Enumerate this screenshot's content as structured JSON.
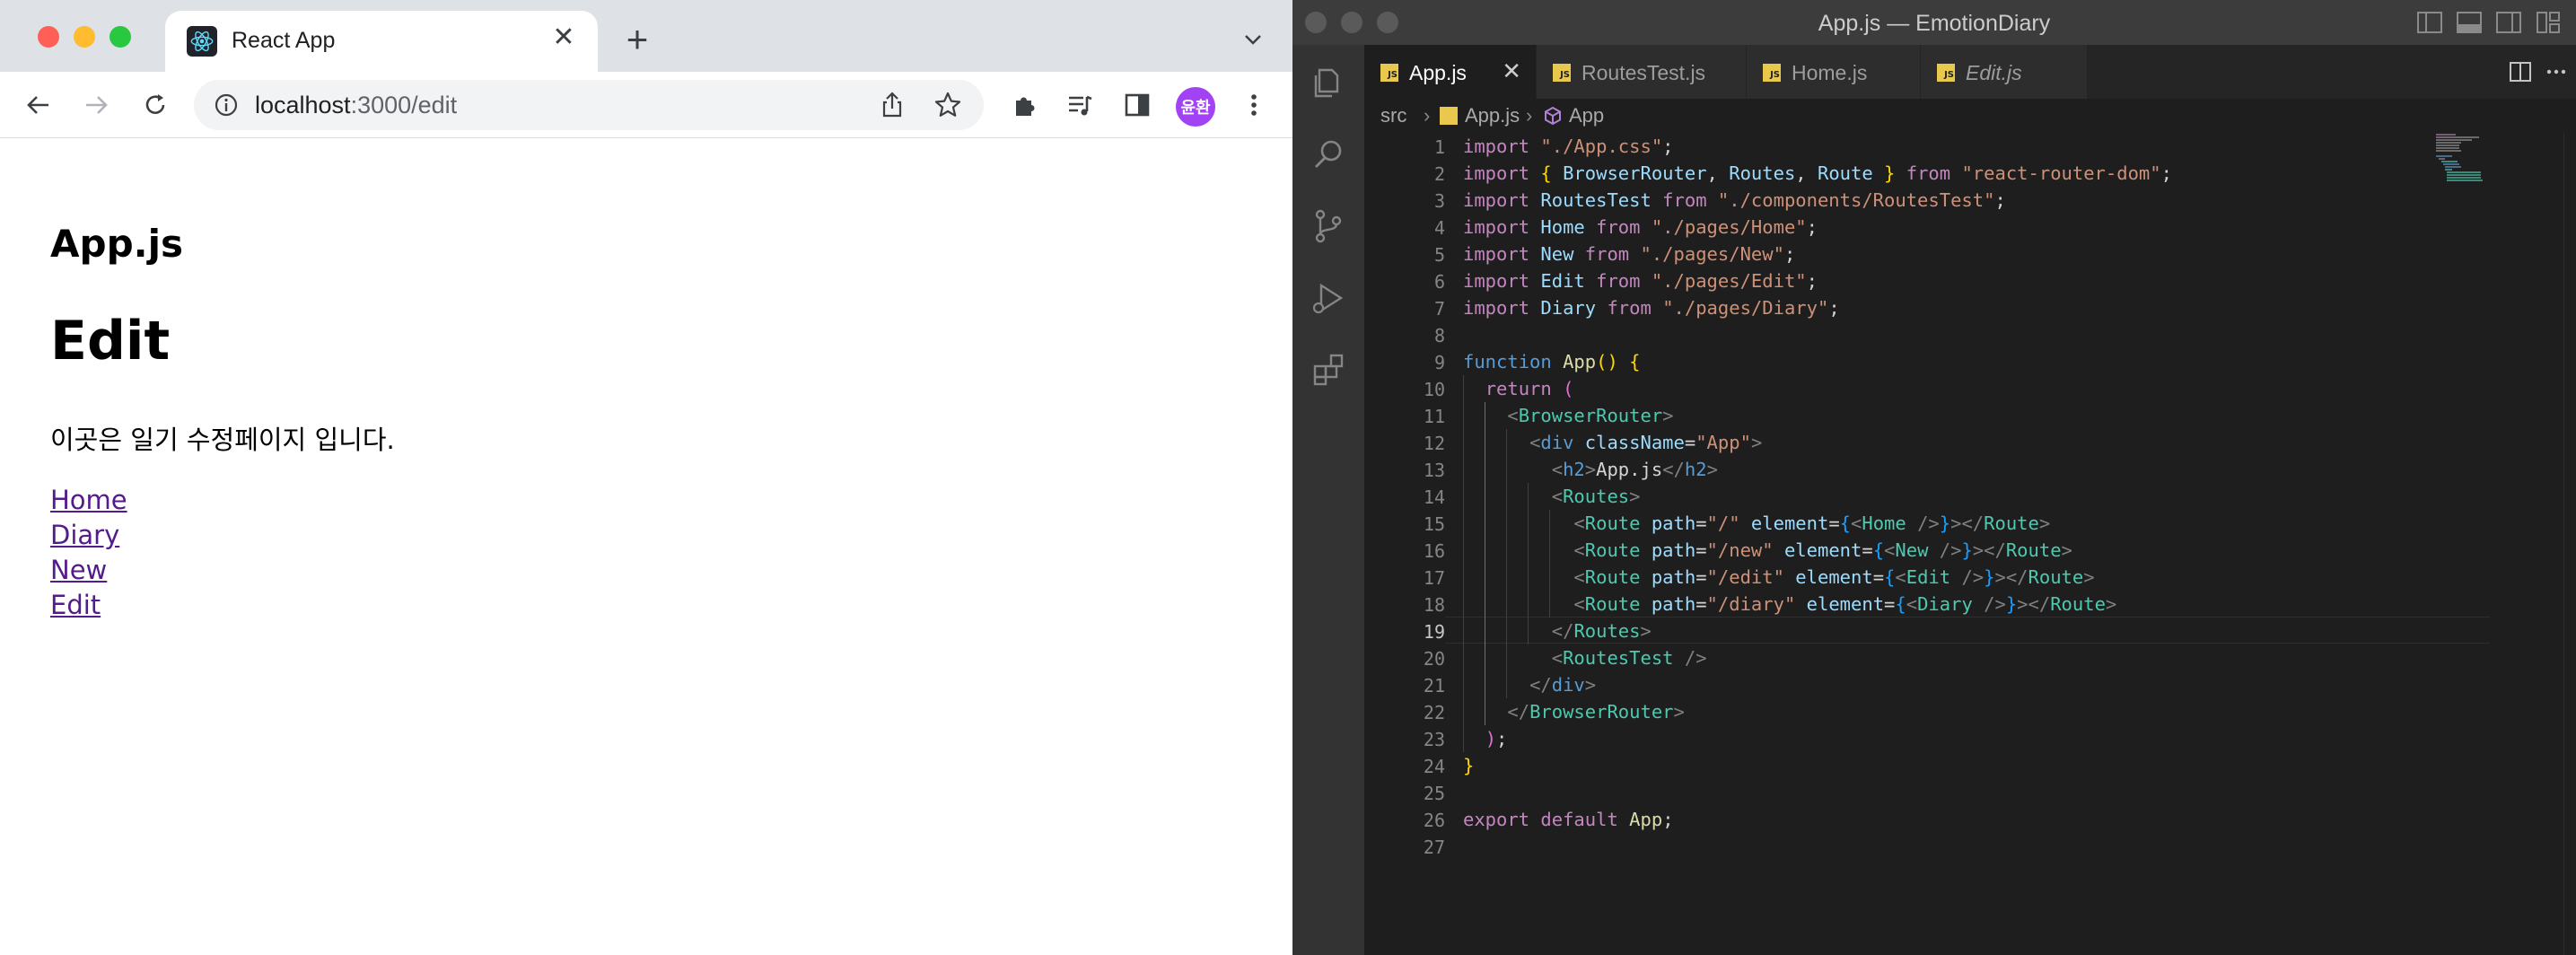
{
  "browser": {
    "tab_title": "React App",
    "url_host": "localhost",
    "url_rest": ":3000/edit",
    "avatar_text": "윤환",
    "avatar_color": "#a142f4"
  },
  "page": {
    "h2": "App.js",
    "h1": "Edit",
    "description": "이곳은 일기 수정페이지 입니다.",
    "links": [
      "Home",
      "Diary",
      "New",
      "Edit"
    ]
  },
  "vscode": {
    "window_title": "App.js — EmotionDiary",
    "tabs": [
      {
        "label": "App.js",
        "active": true,
        "italic": false
      },
      {
        "label": "RoutesTest.js",
        "active": false,
        "italic": false
      },
      {
        "label": "Home.js",
        "active": false,
        "italic": false
      },
      {
        "label": "Edit.js",
        "active": false,
        "italic": true
      }
    ],
    "js_badge": "JS",
    "breadcrumb": [
      "src",
      "App.js",
      "App"
    ],
    "current_line": 19,
    "line_numbers": [
      "1",
      "2",
      "3",
      "4",
      "5",
      "6",
      "7",
      "8",
      "9",
      "10",
      "11",
      "12",
      "13",
      "14",
      "15",
      "16",
      "17",
      "18",
      "19",
      "20",
      "21",
      "22",
      "23",
      "24",
      "25",
      "26",
      "27"
    ]
  }
}
